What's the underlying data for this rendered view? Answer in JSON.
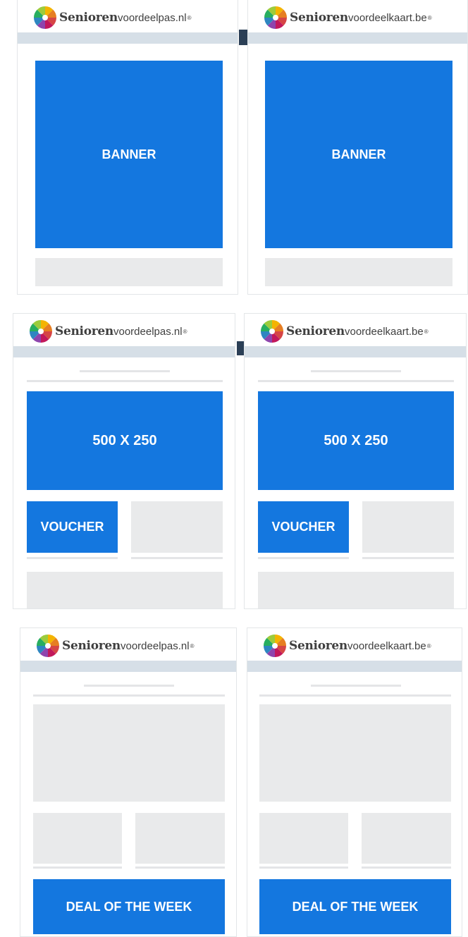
{
  "brand_nl": {
    "bold": "Senioren",
    "light": "voordeelpas.nl",
    "mark": "®"
  },
  "brand_be": {
    "bold": "Senioren",
    "light": "voordeelkaart.be",
    "mark": "®"
  },
  "row1": {
    "label": "BANNER"
  },
  "row2": {
    "banner_label": "500 X 250",
    "voucher_label": "VOUCHER"
  },
  "row3": {
    "deal_label": "DEAL OF THE WEEK"
  },
  "colors": {
    "accent_blue": "#1477df",
    "placeholder_grey": "#e9eaeb",
    "header_bar": "#d6dfe7",
    "dark_marker": "#2b3f56"
  },
  "icons": {
    "logo": "colorful-pinwheel-logo-icon"
  }
}
